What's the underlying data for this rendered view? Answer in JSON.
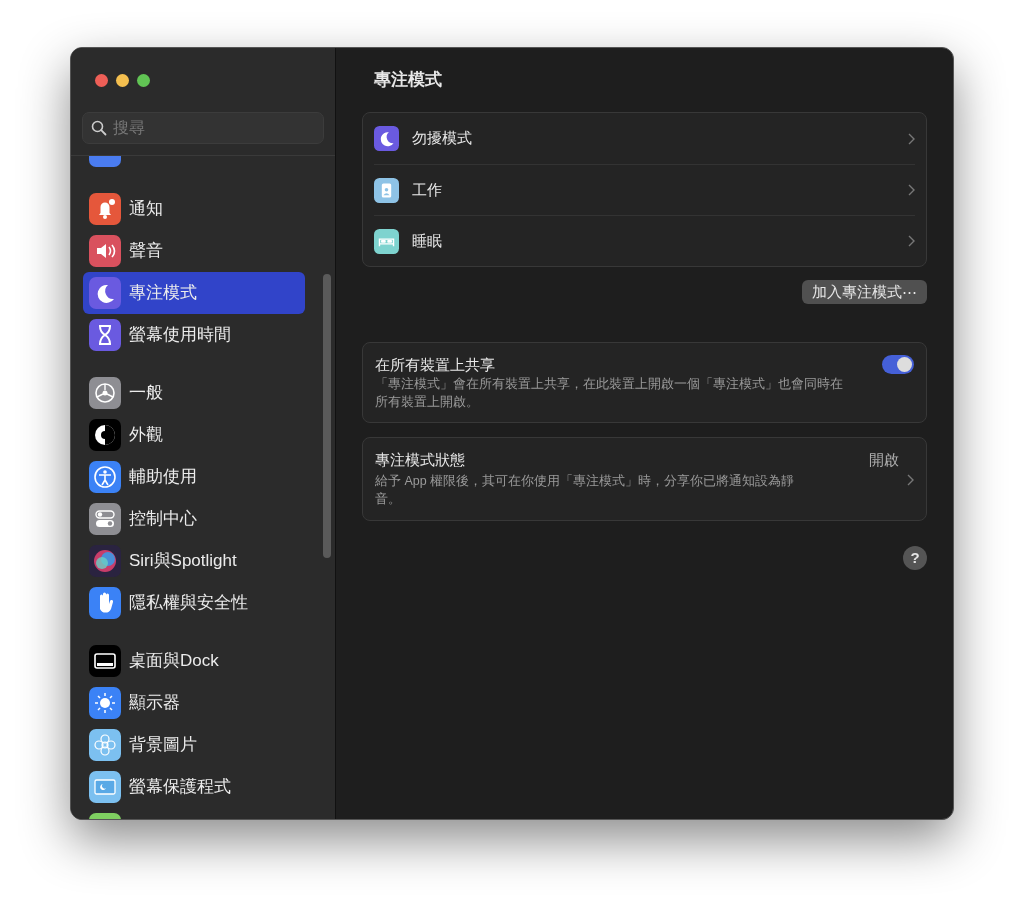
{
  "window": {
    "title": "專注模式"
  },
  "search": {
    "placeholder": "搜尋"
  },
  "sidebar": {
    "groups": [
      {
        "items": [
          {
            "kind": "partial-blue",
            "selected": false
          }
        ]
      },
      {
        "items": [
          {
            "kind": "bell",
            "label": "通知",
            "selected": false
          },
          {
            "kind": "speaker",
            "label": "聲音",
            "selected": false
          },
          {
            "kind": "moon",
            "label": "專注模式",
            "selected": true
          },
          {
            "kind": "hourglass",
            "label": "螢幕使用時間",
            "selected": false
          }
        ]
      },
      {
        "items": [
          {
            "kind": "gear",
            "label": "一般",
            "selected": false
          },
          {
            "kind": "appearance",
            "label": "外觀",
            "selected": false
          },
          {
            "kind": "accessibility",
            "label": "輔助使用",
            "selected": false
          },
          {
            "kind": "toggles",
            "label": "控制中心",
            "selected": false
          },
          {
            "kind": "siri",
            "label": "Siri與Spotlight",
            "selected": false
          },
          {
            "kind": "hand",
            "label": "隱私權與安全性",
            "selected": false
          }
        ]
      },
      {
        "items": [
          {
            "kind": "dock",
            "label": "桌面與Dock",
            "selected": false
          },
          {
            "kind": "sun",
            "label": "顯示器",
            "selected": false
          },
          {
            "kind": "flower",
            "label": "背景圖片",
            "selected": false
          },
          {
            "kind": "screensaver",
            "label": "螢幕保護程式",
            "selected": false
          },
          {
            "kind": "partial-green",
            "selected": false
          }
        ]
      }
    ]
  },
  "focus_modes": [
    {
      "kind": "moon",
      "label": "勿擾模式"
    },
    {
      "kind": "badge",
      "label": "工作"
    },
    {
      "kind": "bed",
      "label": "睡眠"
    }
  ],
  "add_button": "加入專注模式⋯",
  "share": {
    "title": "在所有裝置上共享",
    "description": "「專注模式」會在所有裝置上共享，在此裝置上開啟一個「專注模式」也會同時在所有裝置上開啟。",
    "on": true
  },
  "status": {
    "title": "專注模式狀態",
    "value": "開啟",
    "description": "給予 App 權限後，其可在你使用「專注模式」時，分享你已將通知設為靜音。"
  },
  "help_button": "?"
}
